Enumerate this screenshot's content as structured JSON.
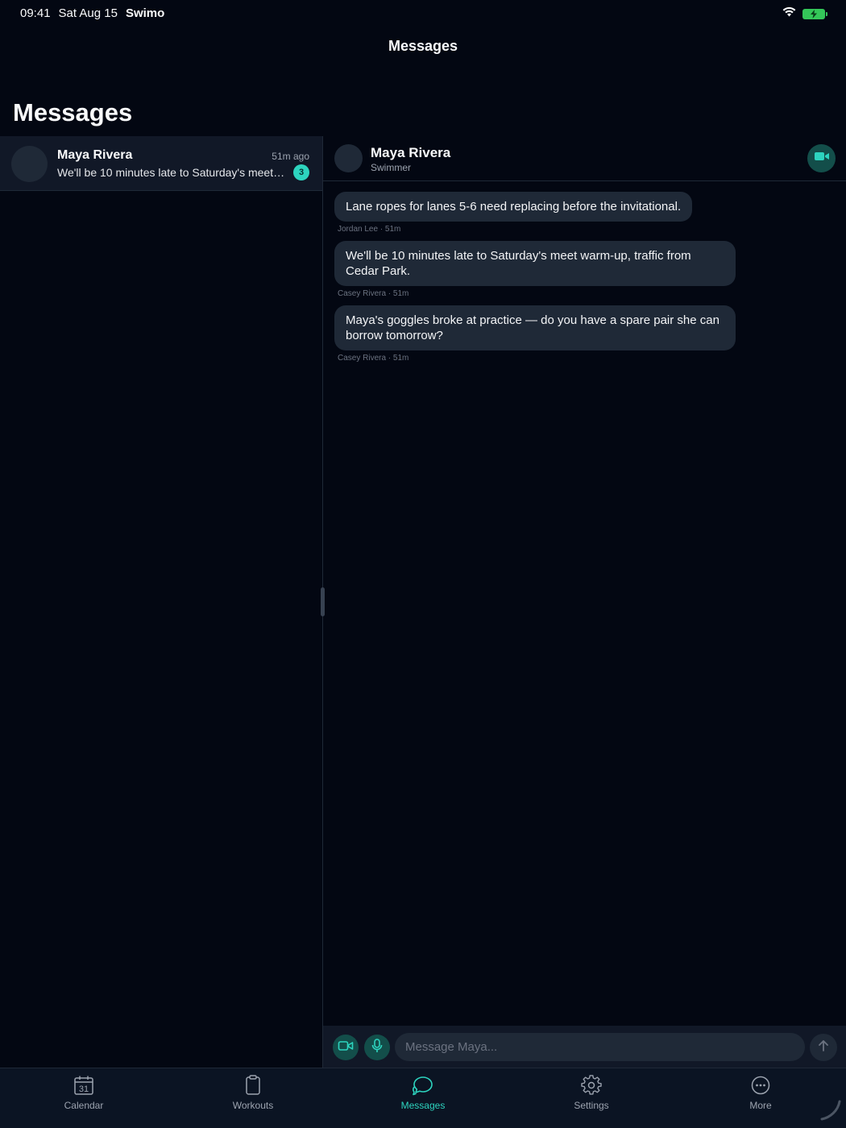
{
  "status_bar": {
    "time": "09:41",
    "date": "Sat Aug 15",
    "app": "Swimo"
  },
  "nav": {
    "title": "Messages"
  },
  "list": {
    "title": "Messages",
    "conversations": [
      {
        "name": "Maya Rivera",
        "time": "51m ago",
        "preview": "We'll be 10 minutes late to Saturday's meet warm-up, traffic from Cedar Park.",
        "unread": "3"
      }
    ]
  },
  "chat": {
    "name": "Maya Rivera",
    "role": "Swimmer",
    "messages": [
      {
        "text": "Lane ropes for lanes 5-6 need replacing before the invitational.",
        "meta": "Jordan Lee · 51m"
      },
      {
        "text": "We'll be 10 minutes late to Saturday's meet warm-up, traffic from Cedar Park.",
        "meta": "Casey Rivera · 51m"
      },
      {
        "text": "Maya's goggles broke at practice — do you have a spare pair she can borrow tomorrow?",
        "meta": "Casey Rivera · 51m"
      }
    ],
    "composer_placeholder": "Message Maya..."
  },
  "tabs": [
    {
      "label": "Calendar",
      "icon": "calendar-icon",
      "day": "31"
    },
    {
      "label": "Workouts",
      "icon": "clipboard-icon"
    },
    {
      "label": "Messages",
      "icon": "chat-bubbles-icon",
      "active": true
    },
    {
      "label": "Settings",
      "icon": "gear-icon"
    },
    {
      "label": "More",
      "icon": "more-dots-icon"
    }
  ],
  "colors": {
    "background": "#030712",
    "accent": "#2dd4bf",
    "bubble": "#1f2937",
    "accent_dark": "#134e4a"
  }
}
